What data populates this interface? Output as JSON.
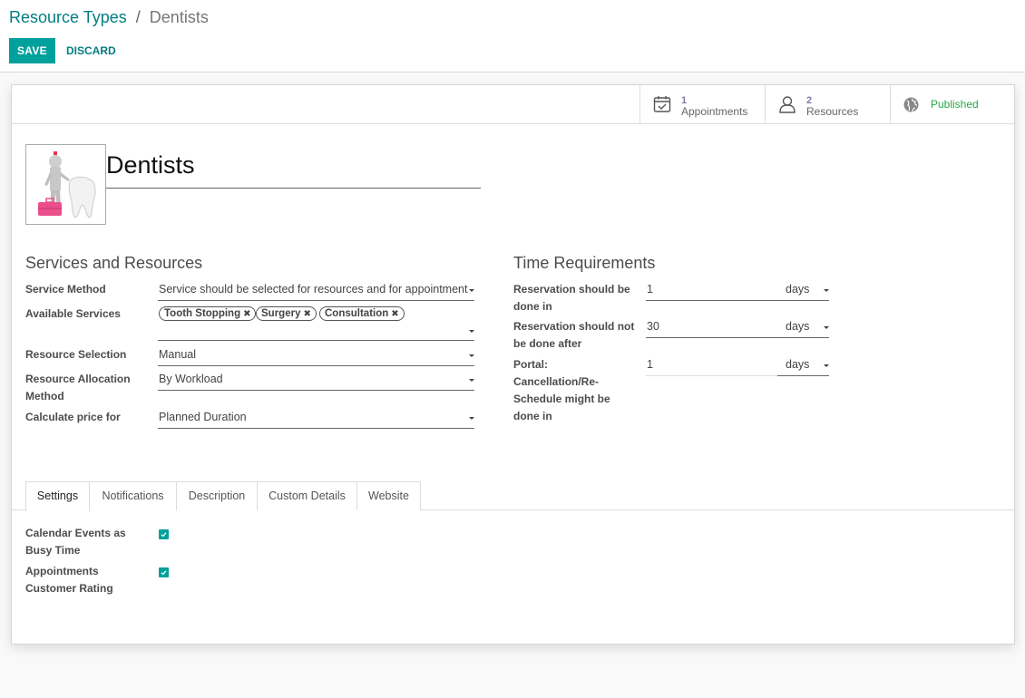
{
  "breadcrumb": {
    "parent": "Resource Types",
    "separator": "/",
    "current": "Dentists"
  },
  "buttons": {
    "save": "SAVE",
    "discard": "DISCARD"
  },
  "stats": {
    "appointments": {
      "count": "1",
      "label": "Appointments"
    },
    "resources": {
      "count": "2",
      "label": "Resources"
    },
    "published": {
      "label": "Published"
    }
  },
  "record": {
    "name": "Dentists"
  },
  "services": {
    "section_title": "Services and Resources",
    "service_method_label": "Service Method",
    "service_method_value": "Service should be selected for resources and for appointment",
    "available_services_label": "Available Services",
    "available_services": [
      "Tooth Stopping",
      "Surgery",
      "Consultation"
    ],
    "resource_selection_label": "Resource Selection",
    "resource_selection_value": "Manual",
    "allocation_label_1": "Resource Allocation",
    "allocation_label_2": "Method",
    "allocation_value": "By Workload",
    "price_label": "Calculate price for",
    "price_value": "Planned Duration"
  },
  "time": {
    "section_title": "Time Requirements",
    "r1_label_1": "Reservation should be",
    "r1_label_2": "done in",
    "r1_value": "1",
    "r1_unit": "days",
    "r2_label_1": "Reservation should not",
    "r2_label_2": "be done after",
    "r2_value": "30",
    "r2_unit": "days",
    "r3_label_1": "Portal:",
    "r3_label_2": "Cancellation/Re-",
    "r3_label_3": "Schedule might be",
    "r3_label_4": "done in",
    "r3_value": "1",
    "r3_unit": "days"
  },
  "tabs": [
    "Settings",
    "Notifications",
    "Description",
    "Custom Details",
    "Website"
  ],
  "settings": {
    "busy_label_1": "Calendar Events as",
    "busy_label_2": "Busy Time",
    "busy_checked": true,
    "rating_label_1": "Appointments",
    "rating_label_2": "Customer Rating",
    "rating_checked": true
  },
  "colors": {
    "primary": "#00a09d",
    "link": "#017e84",
    "published": "#28a745",
    "stat_count": "#7c7bad"
  }
}
